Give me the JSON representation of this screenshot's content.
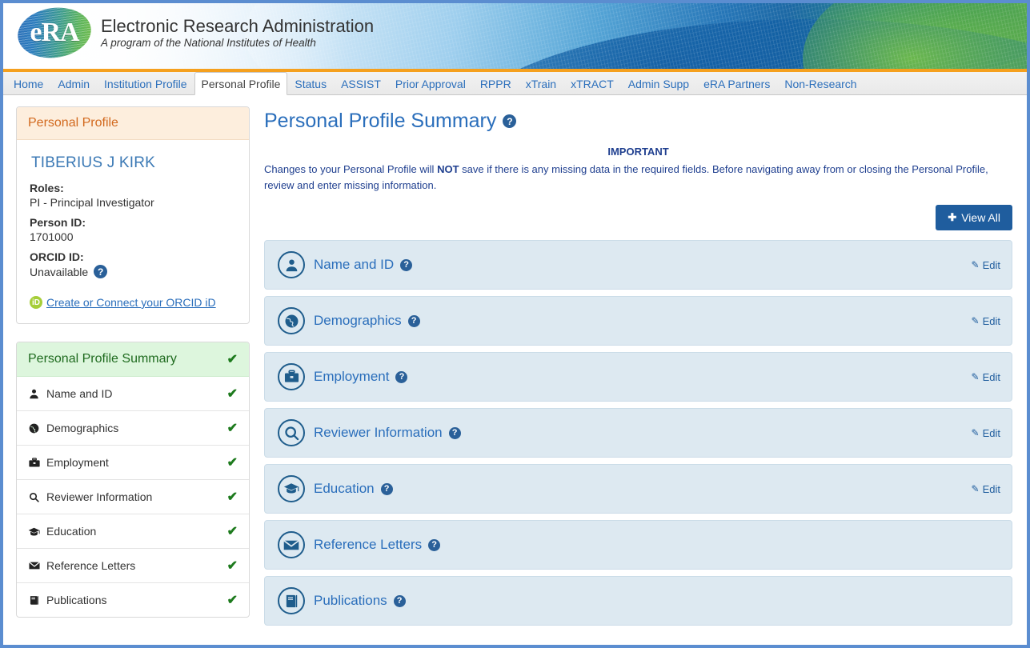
{
  "brand": {
    "logo_text": "eRA",
    "logo_icon": "era-oval-logo",
    "title": "Electronic Research Administration",
    "subtitle": "A program of the National Institutes of Health"
  },
  "tabs": [
    {
      "label": "Home",
      "active": false
    },
    {
      "label": "Admin",
      "active": false
    },
    {
      "label": "Institution Profile",
      "active": false
    },
    {
      "label": "Personal Profile",
      "active": true
    },
    {
      "label": "Status",
      "active": false
    },
    {
      "label": "ASSIST",
      "active": false
    },
    {
      "label": "Prior Approval",
      "active": false
    },
    {
      "label": "RPPR",
      "active": false
    },
    {
      "label": "xTrain",
      "active": false
    },
    {
      "label": "xTRACT",
      "active": false
    },
    {
      "label": "Admin Supp",
      "active": false
    },
    {
      "label": "eRA Partners",
      "active": false
    },
    {
      "label": "Non-Research",
      "active": false
    }
  ],
  "sidebar": {
    "profile_card": {
      "header": "Personal Profile",
      "person_name": "TIBERIUS J KIRK",
      "roles_label": "Roles:",
      "roles_value": "PI - Principal Investigator",
      "person_id_label": "Person ID:",
      "person_id_value": "1701000",
      "orcid_id_label": "ORCID ID:",
      "orcid_id_value": "Unavailable",
      "orcid_help": "?",
      "orcid_link": "Create or Connect your ORCID iD",
      "orcid_badge_text": "iD"
    },
    "summary_nav": {
      "header": "Personal Profile Summary",
      "header_check": "✔",
      "items": [
        {
          "label": "Name and ID",
          "icon": "person-icon",
          "check": "✔"
        },
        {
          "label": "Demographics",
          "icon": "globe-icon",
          "check": "✔"
        },
        {
          "label": "Employment",
          "icon": "briefcase-icon",
          "check": "✔"
        },
        {
          "label": "Reviewer Information",
          "icon": "magnifier-icon",
          "check": "✔"
        },
        {
          "label": "Education",
          "icon": "graduation-cap-icon",
          "check": "✔"
        },
        {
          "label": "Reference Letters",
          "icon": "envelope-icon",
          "check": "✔"
        },
        {
          "label": "Publications",
          "icon": "book-icon",
          "check": "✔"
        }
      ]
    }
  },
  "main": {
    "page_title": "Personal Profile Summary",
    "page_title_help": "?",
    "important_heading": "IMPORTANT",
    "notice_part1": "Changes to your Personal Profile will ",
    "notice_bold": "NOT",
    "notice_part2": " save if there is any missing data in the required fields. Before navigating away from or closing the Personal Profile, review and enter missing information.",
    "view_all_button": "View All",
    "view_all_plus": "✚",
    "edit_label": "Edit",
    "sections": [
      {
        "label": "Name and ID",
        "icon": "person-circle-icon",
        "help": "?",
        "has_edit": true
      },
      {
        "label": "Demographics",
        "icon": "globe-circle-icon",
        "help": "?",
        "has_edit": true
      },
      {
        "label": "Employment",
        "icon": "briefcase-circle-icon",
        "help": "?",
        "has_edit": true
      },
      {
        "label": "Reviewer Information",
        "icon": "magnifier-circle-icon",
        "help": "?",
        "has_edit": true
      },
      {
        "label": "Education",
        "icon": "graduation-circle-icon",
        "help": "?",
        "has_edit": true
      },
      {
        "label": "Reference Letters",
        "icon": "envelope-circle-icon",
        "help": "?",
        "has_edit": false
      },
      {
        "label": "Publications",
        "icon": "book-circle-icon",
        "help": "?",
        "has_edit": false
      }
    ]
  },
  "colors": {
    "accent_blue": "#2a6ebb",
    "header_orange_rule": "#f5a01e",
    "panel_orange_bg": "#fdeedd",
    "panel_orange_text": "#d2691e",
    "panel_green_bg": "#ddf6dd",
    "panel_green_text": "#1f6b1f",
    "accordion_bg": "#dde9f1",
    "accordion_icon": "#1f5d8c",
    "button_blue": "#1f5d9e",
    "notice_text": "#1f3f8f",
    "check_green": "#1d7a1d",
    "frame_border": "#5b8dd0"
  }
}
